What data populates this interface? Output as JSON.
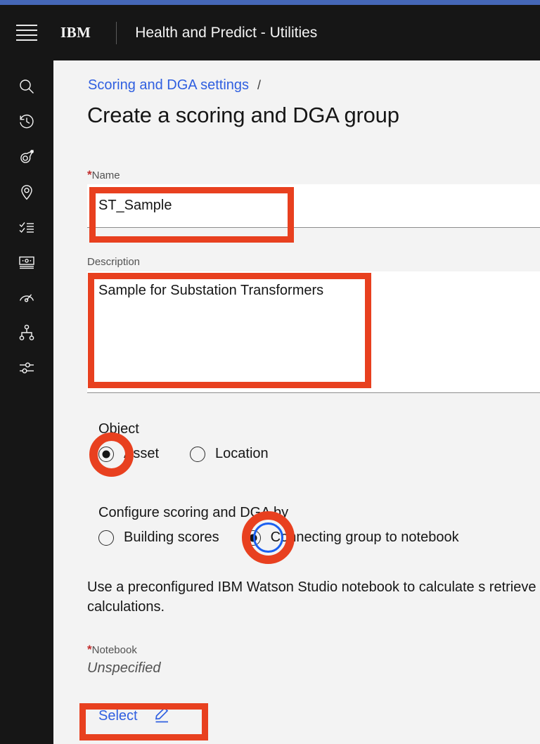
{
  "header": {
    "menu_icon": "hamburger-menu-icon",
    "brand": "IBM",
    "app_title": "Health and Predict - Utilities"
  },
  "sidebar": {
    "items": [
      {
        "icon": "search-icon",
        "label": "Search"
      },
      {
        "icon": "history-icon",
        "label": "Recently viewed"
      },
      {
        "icon": "asset-tag-icon",
        "label": "Assets"
      },
      {
        "icon": "location-pin-icon",
        "label": "Locations"
      },
      {
        "icon": "checklist-icon",
        "label": "Work orders"
      },
      {
        "icon": "card-reader-icon",
        "label": "Meters"
      },
      {
        "icon": "gauge-icon",
        "label": "Health scores"
      },
      {
        "icon": "hierarchy-icon",
        "label": "Groups"
      },
      {
        "icon": "sliders-icon",
        "label": "Settings"
      }
    ]
  },
  "main": {
    "breadcrumb": {
      "link": "Scoring and DGA settings",
      "separator": "/"
    },
    "page_title": "Create a scoring and DGA group",
    "name_field": {
      "label": "Name",
      "required_marker": "*",
      "value": "ST_Sample",
      "placeholder": ""
    },
    "description_field": {
      "label": "Description",
      "value": "Sample for Substation Transformers",
      "placeholder": ""
    },
    "object_group": {
      "label": "Object",
      "options": [
        {
          "label": "Asset",
          "selected": true
        },
        {
          "label": "Location",
          "selected": false
        }
      ]
    },
    "configure_group": {
      "label": "Configure scoring and DGA by",
      "options": [
        {
          "label": "Building scores",
          "selected": false
        },
        {
          "label": "Connecting group to notebook",
          "selected": true
        }
      ]
    },
    "helper_text": "Use a preconfigured IBM Watson Studio notebook to calculate s retrieve new calculations.",
    "notebook_field": {
      "label": "Notebook",
      "required_marker": "*",
      "value": "Unspecified",
      "select_label": "Select",
      "select_icon": "edit-pencil-icon"
    }
  },
  "colors": {
    "accent_bar": "#4567b7",
    "header_bg": "#161616",
    "content_bg": "#f3f3f3",
    "link": "#2f5fe0",
    "annotation_red": "#e8401f",
    "focus_blue": "#1b5ff0",
    "required_red": "#c22e2e"
  }
}
